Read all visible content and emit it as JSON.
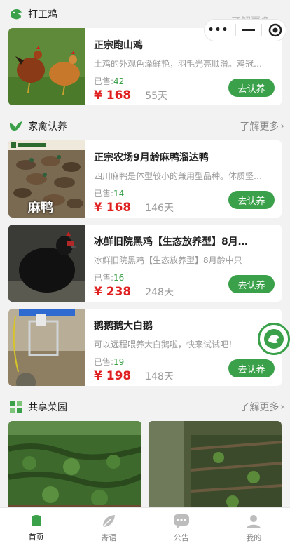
{
  "header_capsule": {
    "dots_label": "•••"
  },
  "sections": {
    "chicken": {
      "title": "打工鸡",
      "more": "了解更多"
    },
    "poultry": {
      "title": "家禽认养",
      "more": "了解更多"
    },
    "garden": {
      "title": "共享菜园",
      "more": "了解更多"
    }
  },
  "products": [
    {
      "name": "正宗跑山鸡",
      "desc": "土鸡的外观色泽鲜艳，羽毛光亮顺滑。鸡冠…",
      "sold_label": "已售:",
      "sold": "42",
      "price": "¥ 168",
      "days": "55天",
      "button": "去认养"
    },
    {
      "name": "正宗农场9月龄麻鸭溜达鸭",
      "desc": "四川麻鸭是体型较小的兼用型品种。体质坚…",
      "sold_label": "已售:",
      "sold": "14",
      "price": "¥ 168",
      "days": "146天",
      "button": "去认养",
      "thumb_caption": "麻鸭"
    },
    {
      "name": "冰鲜旧院黑鸡【生态放养型】8月…",
      "desc": "冰鲜旧院黑鸡【生态放养型】8月龄中只",
      "sold_label": "已售:",
      "sold": "16",
      "price": "¥ 238",
      "days": "248天",
      "button": "去认养"
    },
    {
      "name": "鹅鹅鹅大白鹅",
      "desc": "可以远程喂养大白鹅啦，快来试试吧！",
      "sold_label": "已售:",
      "sold": "19",
      "price": "¥ 198",
      "days": "148天",
      "button": "去认养"
    }
  ],
  "tabbar": [
    {
      "label": "首页",
      "icon": "home-icon",
      "active": true
    },
    {
      "label": "寄语",
      "icon": "leaf-icon",
      "active": false
    },
    {
      "label": "公告",
      "icon": "chat-icon",
      "active": false
    },
    {
      "label": "我的",
      "icon": "user-icon",
      "active": false
    }
  ],
  "colors": {
    "accent": "#3aa14a",
    "price": "#e02020",
    "muted": "#999999"
  }
}
